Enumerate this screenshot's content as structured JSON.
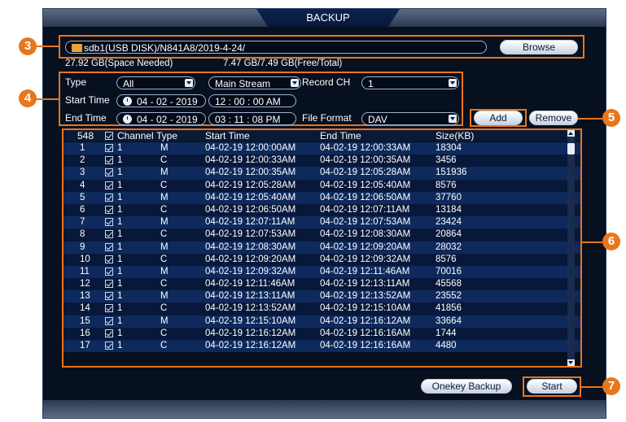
{
  "window": {
    "title": "BACKUP"
  },
  "path": {
    "value": "sdb1(USB DISK)/N841A8/2019-4-24/",
    "browse_label": "Browse"
  },
  "space": {
    "needed": "27.92 GB(Space Needed)",
    "free_total": "7.47 GB/7.49 GB(Free/Total)"
  },
  "filters": {
    "type_label": "Type",
    "type_value": "All",
    "stream_value": "Main Stream",
    "record_ch_label": "Record CH",
    "record_ch_value": "1",
    "start_label": "Start Time",
    "start_date": "04 - 02 - 2019",
    "start_time": "12 : 00 : 00 AM",
    "end_label": "End Time",
    "end_date": "04 - 02 - 2019",
    "end_time": "03 : 11 : 08 PM",
    "file_format_label": "File Format",
    "file_format_value": "DAV"
  },
  "buttons": {
    "add": "Add",
    "remove": "Remove",
    "onekey": "Onekey Backup",
    "start": "Start"
  },
  "callouts": {
    "c3": "3",
    "c4": "4",
    "c5": "5",
    "c6": "6",
    "c7": "7"
  },
  "table": {
    "headers": {
      "count": "548",
      "channel": "Channel",
      "type": "Type",
      "start": "Start Time",
      "end": "End Time",
      "size": "Size(KB)"
    },
    "rows": [
      {
        "no": "1",
        "ch": "1",
        "type": "M",
        "start": "04-02-19 12:00:00AM",
        "end": "04-02-19 12:00:33AM",
        "size": "18304"
      },
      {
        "no": "2",
        "ch": "1",
        "type": "C",
        "start": "04-02-19 12:00:33AM",
        "end": "04-02-19 12:00:35AM",
        "size": "3456"
      },
      {
        "no": "3",
        "ch": "1",
        "type": "M",
        "start": "04-02-19 12:00:35AM",
        "end": "04-02-19 12:05:28AM",
        "size": "151936"
      },
      {
        "no": "4",
        "ch": "1",
        "type": "C",
        "start": "04-02-19 12:05:28AM",
        "end": "04-02-19 12:05:40AM",
        "size": "8576"
      },
      {
        "no": "5",
        "ch": "1",
        "type": "M",
        "start": "04-02-19 12:05:40AM",
        "end": "04-02-19 12:06:50AM",
        "size": "37760"
      },
      {
        "no": "6",
        "ch": "1",
        "type": "C",
        "start": "04-02-19 12:06:50AM",
        "end": "04-02-19 12:07:11AM",
        "size": "13184"
      },
      {
        "no": "7",
        "ch": "1",
        "type": "M",
        "start": "04-02-19 12:07:11AM",
        "end": "04-02-19 12:07:53AM",
        "size": "23424"
      },
      {
        "no": "8",
        "ch": "1",
        "type": "C",
        "start": "04-02-19 12:07:53AM",
        "end": "04-02-19 12:08:30AM",
        "size": "20864"
      },
      {
        "no": "9",
        "ch": "1",
        "type": "M",
        "start": "04-02-19 12:08:30AM",
        "end": "04-02-19 12:09:20AM",
        "size": "28032"
      },
      {
        "no": "10",
        "ch": "1",
        "type": "C",
        "start": "04-02-19 12:09:20AM",
        "end": "04-02-19 12:09:32AM",
        "size": "8576"
      },
      {
        "no": "11",
        "ch": "1",
        "type": "M",
        "start": "04-02-19 12:09:32AM",
        "end": "04-02-19 12:11:46AM",
        "size": "70016"
      },
      {
        "no": "12",
        "ch": "1",
        "type": "C",
        "start": "04-02-19 12:11:46AM",
        "end": "04-02-19 12:13:11AM",
        "size": "45568"
      },
      {
        "no": "13",
        "ch": "1",
        "type": "M",
        "start": "04-02-19 12:13:11AM",
        "end": "04-02-19 12:13:52AM",
        "size": "23552"
      },
      {
        "no": "14",
        "ch": "1",
        "type": "C",
        "start": "04-02-19 12:13:52AM",
        "end": "04-02-19 12:15:10AM",
        "size": "41856"
      },
      {
        "no": "15",
        "ch": "1",
        "type": "M",
        "start": "04-02-19 12:15:10AM",
        "end": "04-02-19 12:16:12AM",
        "size": "33664"
      },
      {
        "no": "16",
        "ch": "1",
        "type": "C",
        "start": "04-02-19 12:16:12AM",
        "end": "04-02-19 12:16:16AM",
        "size": "1744"
      },
      {
        "no": "17",
        "ch": "1",
        "type": "C",
        "start": "04-02-19 12:16:12AM",
        "end": "04-02-19 12:16:16AM",
        "size": "4480"
      }
    ]
  },
  "colors": {
    "accent": "#e8761d",
    "row_odd": "#0e2a5c",
    "row_even": "#08183a",
    "background": "#06101f"
  }
}
